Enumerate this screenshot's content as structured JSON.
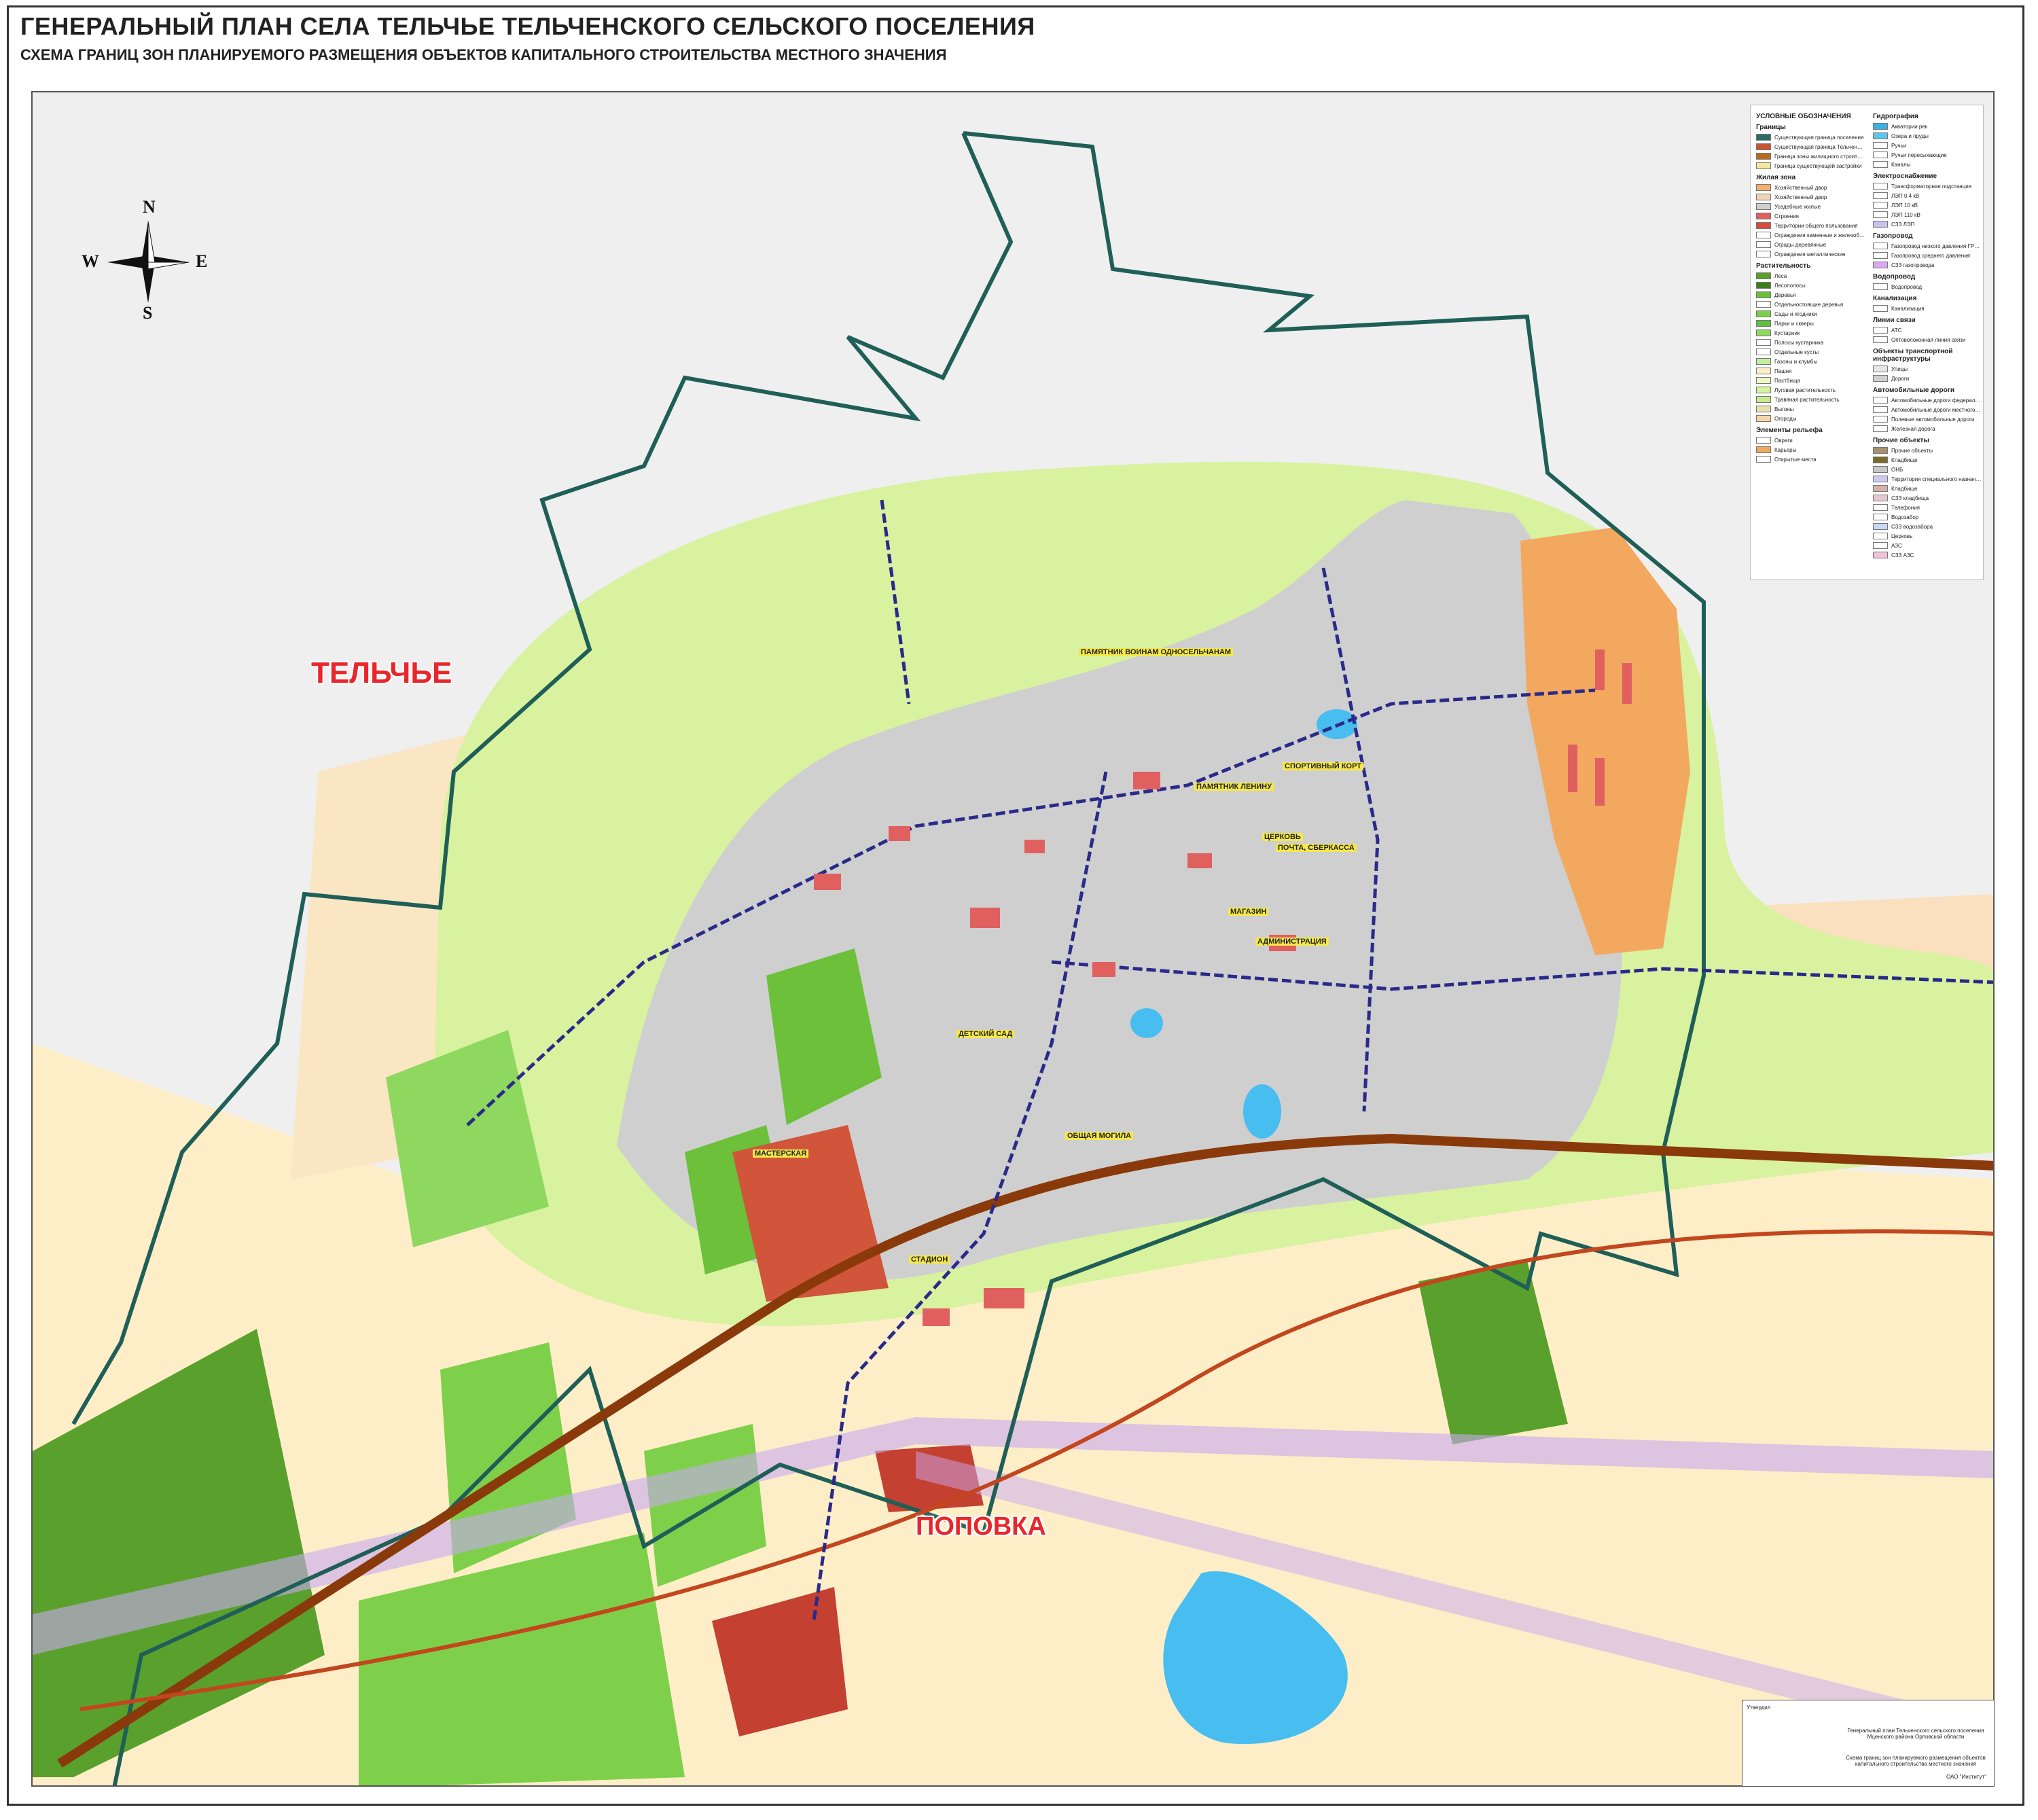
{
  "header": {
    "title": "ГЕНЕРАЛЬНЫЙ ПЛАН СЕЛА ТЕЛЬЧЬЕ ТЕЛЬЧЕНСКОГО СЕЛЬСКОГО ПОСЕЛЕНИЯ",
    "subtitle": "СХЕМА ГРАНИЦ ЗОН ПЛАНИРУЕМОГО РАЗМЕЩЕНИЯ ОБЪЕКТОВ КАПИТАЛЬНОГО СТРОИТЕЛЬСТВА МЕСТНОГО ЗНАЧЕНИЯ"
  },
  "compass": {
    "n": "N",
    "s": "S",
    "w": "W",
    "e": "E"
  },
  "places": {
    "telche": "ТЕЛЬЧЬЕ",
    "popovka": "ПОПОВКА"
  },
  "map_labels": [
    "ПАМЯТНИК ВОИНАМ ОДНОСЕЛЬЧАНАМ",
    "ПАМЯТНИК ЛЕНИНУ",
    "СПОРТИВНЫЙ КОРТ",
    "ЦЕРКОВЬ",
    "ПОЧТА, СБЕРКАССА",
    "МАГАЗИН",
    "АДМИНИСТРАЦИЯ",
    "ОБЩАЯ МОГИЛА",
    "МАСТЕРСКАЯ",
    "СТАДИОН",
    "ДЕТСКИЙ САД"
  ],
  "legend": {
    "title": "УСЛОВНЫЕ ОБОЗНАЧЕНИЯ",
    "col1": [
      {
        "section": "Границы"
      },
      {
        "label": "Существующая граница поселения",
        "color": "#2a6b63"
      },
      {
        "label": "Существующая граница Тельченского сельского поселения",
        "color": "#c8552e"
      },
      {
        "label": "Граница зоны жилищного строительства",
        "color": "#b86a1e"
      },
      {
        "label": "Граница существующей застройки",
        "color": "#f3e79a"
      },
      {
        "section": "Жилая зона"
      },
      {
        "label": "Хозяйственный двор",
        "color": "#f3b06a"
      },
      {
        "label": "Хозяйственный двор",
        "color": "#f0d3b2"
      },
      {
        "label": "Усадебные жилые",
        "color": "#cfcfcf"
      },
      {
        "label": "Строения",
        "color": "#e06060"
      },
      {
        "label": "Территории общего пользования",
        "color": "#d64d3a"
      },
      {
        "label": "Ограждения каменные и железобетонные",
        "color": "#ffffff"
      },
      {
        "label": "Ограды деревянные",
        "color": "#ffffff"
      },
      {
        "label": "Ограждения металлические",
        "color": "#ffffff"
      },
      {
        "section": "Растительность"
      },
      {
        "label": "Леса",
        "color": "#5aa02c"
      },
      {
        "label": "Лесополосы",
        "color": "#3a7d1e"
      },
      {
        "label": "Деревья",
        "color": "#6cbf3a"
      },
      {
        "label": "Отдельностоящие деревья",
        "color": "#ffffff"
      },
      {
        "label": "Сады и ягодники",
        "color": "#7ad04a"
      },
      {
        "label": "Парки и скверы",
        "color": "#5fc040"
      },
      {
        "label": "Кустарник",
        "color": "#8ed860"
      },
      {
        "label": "Полосы кустарника",
        "color": "#ffffff"
      },
      {
        "label": "Отдельные кусты",
        "color": "#ffffff"
      },
      {
        "label": "Газоны и клумбы",
        "color": "#bff0a0"
      },
      {
        "label": "Пашня",
        "color": "#fdeec8"
      },
      {
        "label": "Пастбища",
        "color": "#eef8c0"
      },
      {
        "label": "Луговая растительность",
        "color": "#d4f29a"
      },
      {
        "label": "Травяная растительность",
        "color": "#c6ec8a"
      },
      {
        "label": "Выгоны",
        "color": "#e8e0b0"
      },
      {
        "label": "Огороды",
        "color": "#f6d6a8"
      },
      {
        "section": "Элементы рельефа"
      },
      {
        "label": "Овраги",
        "color": "#ffffff"
      },
      {
        "label": "Карьеры",
        "color": "#f0a860"
      },
      {
        "label": "Открытые места",
        "color": "#ffffff"
      }
    ],
    "col2": [
      {
        "section": "Гидрография"
      },
      {
        "label": "Акватории рек",
        "color": "#3ab0e8"
      },
      {
        "label": "Озера и пруды",
        "color": "#5ec4f0"
      },
      {
        "label": "Ручьи",
        "color": "#ffffff"
      },
      {
        "label": "Ручьи пересыхающие",
        "color": "#ffffff"
      },
      {
        "label": "Каналы",
        "color": "#ffffff"
      },
      {
        "section": "Электроснабжение"
      },
      {
        "label": "Трансформаторная подстанция",
        "color": "#ffffff"
      },
      {
        "label": "ЛЭП 0.4 кВ",
        "color": "#ffffff"
      },
      {
        "label": "ЛЭП 10 кВ",
        "color": "#ffffff"
      },
      {
        "label": "ЛЭП 110 кВ",
        "color": "#ffffff"
      },
      {
        "label": "СЗЗ ЛЭП",
        "color": "#c8c0f0"
      },
      {
        "section": "Газопровод"
      },
      {
        "label": "Газопровод низкого давления ГРПШ",
        "color": "#ffffff"
      },
      {
        "label": "Газопровод среднего давления",
        "color": "#ffffff"
      },
      {
        "label": "СЗЗ газопровода",
        "color": "#d8a8f0"
      },
      {
        "section": "Водопровод"
      },
      {
        "label": "Водопровод",
        "color": "#ffffff"
      },
      {
        "section": "Канализация"
      },
      {
        "label": "Канализация",
        "color": "#ffffff"
      },
      {
        "section": "Линии связи"
      },
      {
        "label": "АТС",
        "color": "#ffffff"
      },
      {
        "label": "Оптоволоконная линия связи",
        "color": "#ffffff"
      },
      {
        "section": "Объекты транспортной инфраструктуры"
      },
      {
        "label": "Улицы",
        "color": "#e6e6e6"
      },
      {
        "label": "Дороги",
        "color": "#d0d0d0"
      },
      {
        "section": "Автомобильные дороги"
      },
      {
        "label": "Автомобильные дороги федерального значения",
        "color": "#ffffff"
      },
      {
        "label": "Автомобильные дороги местного значения",
        "color": "#ffffff"
      },
      {
        "label": "Полевые автомобильные дороги",
        "color": "#ffffff"
      },
      {
        "label": "Железная дорога",
        "color": "#ffffff"
      },
      {
        "section": "Прочие объекты"
      },
      {
        "label": "Прочие объекты",
        "color": "#a89070"
      },
      {
        "label": "Кладбище",
        "color": "#7a6a2a"
      },
      {
        "label": "ОНБ",
        "color": "#c8c8c8"
      },
      {
        "label": "Территория специального назначения",
        "color": "#d0c8f0"
      },
      {
        "label": "Кладбище",
        "color": "#d8b0a8"
      },
      {
        "label": "СЗЗ кладбища",
        "color": "#e8c8d0"
      },
      {
        "label": "Телефония",
        "color": "#ffffff"
      },
      {
        "label": "Водозабор",
        "color": "#ffffff"
      },
      {
        "label": "СЗЗ водозабора",
        "color": "#c8d8f8"
      },
      {
        "label": "Церковь",
        "color": "#ffffff"
      },
      {
        "label": "АЗС",
        "color": "#ffffff"
      },
      {
        "label": "СЗЗ АЗС",
        "color": "#f4c0d8"
      }
    ]
  },
  "stamp": {
    "left_text": "Утвердил",
    "center_text": "Генеральный план Тельченского сельского поселения Мценского района Орловской области",
    "right_text": "Схема границ зон планируемого размещения объектов капитального строительства местного значения",
    "org": "ОАО \"Институт\""
  },
  "colors": {
    "boundary": "#1f5f58",
    "residential": "#cfcfcf",
    "buildings": "#e06060",
    "green": "#7ed04a",
    "meadow": "#d8f2a0",
    "field": "#fdeec8",
    "water": "#48bdf0",
    "industrial": "#f3a860",
    "road": "#8a3a0a",
    "gas": "#2a2a8a",
    "gas_zone": "#c8a8f0"
  }
}
